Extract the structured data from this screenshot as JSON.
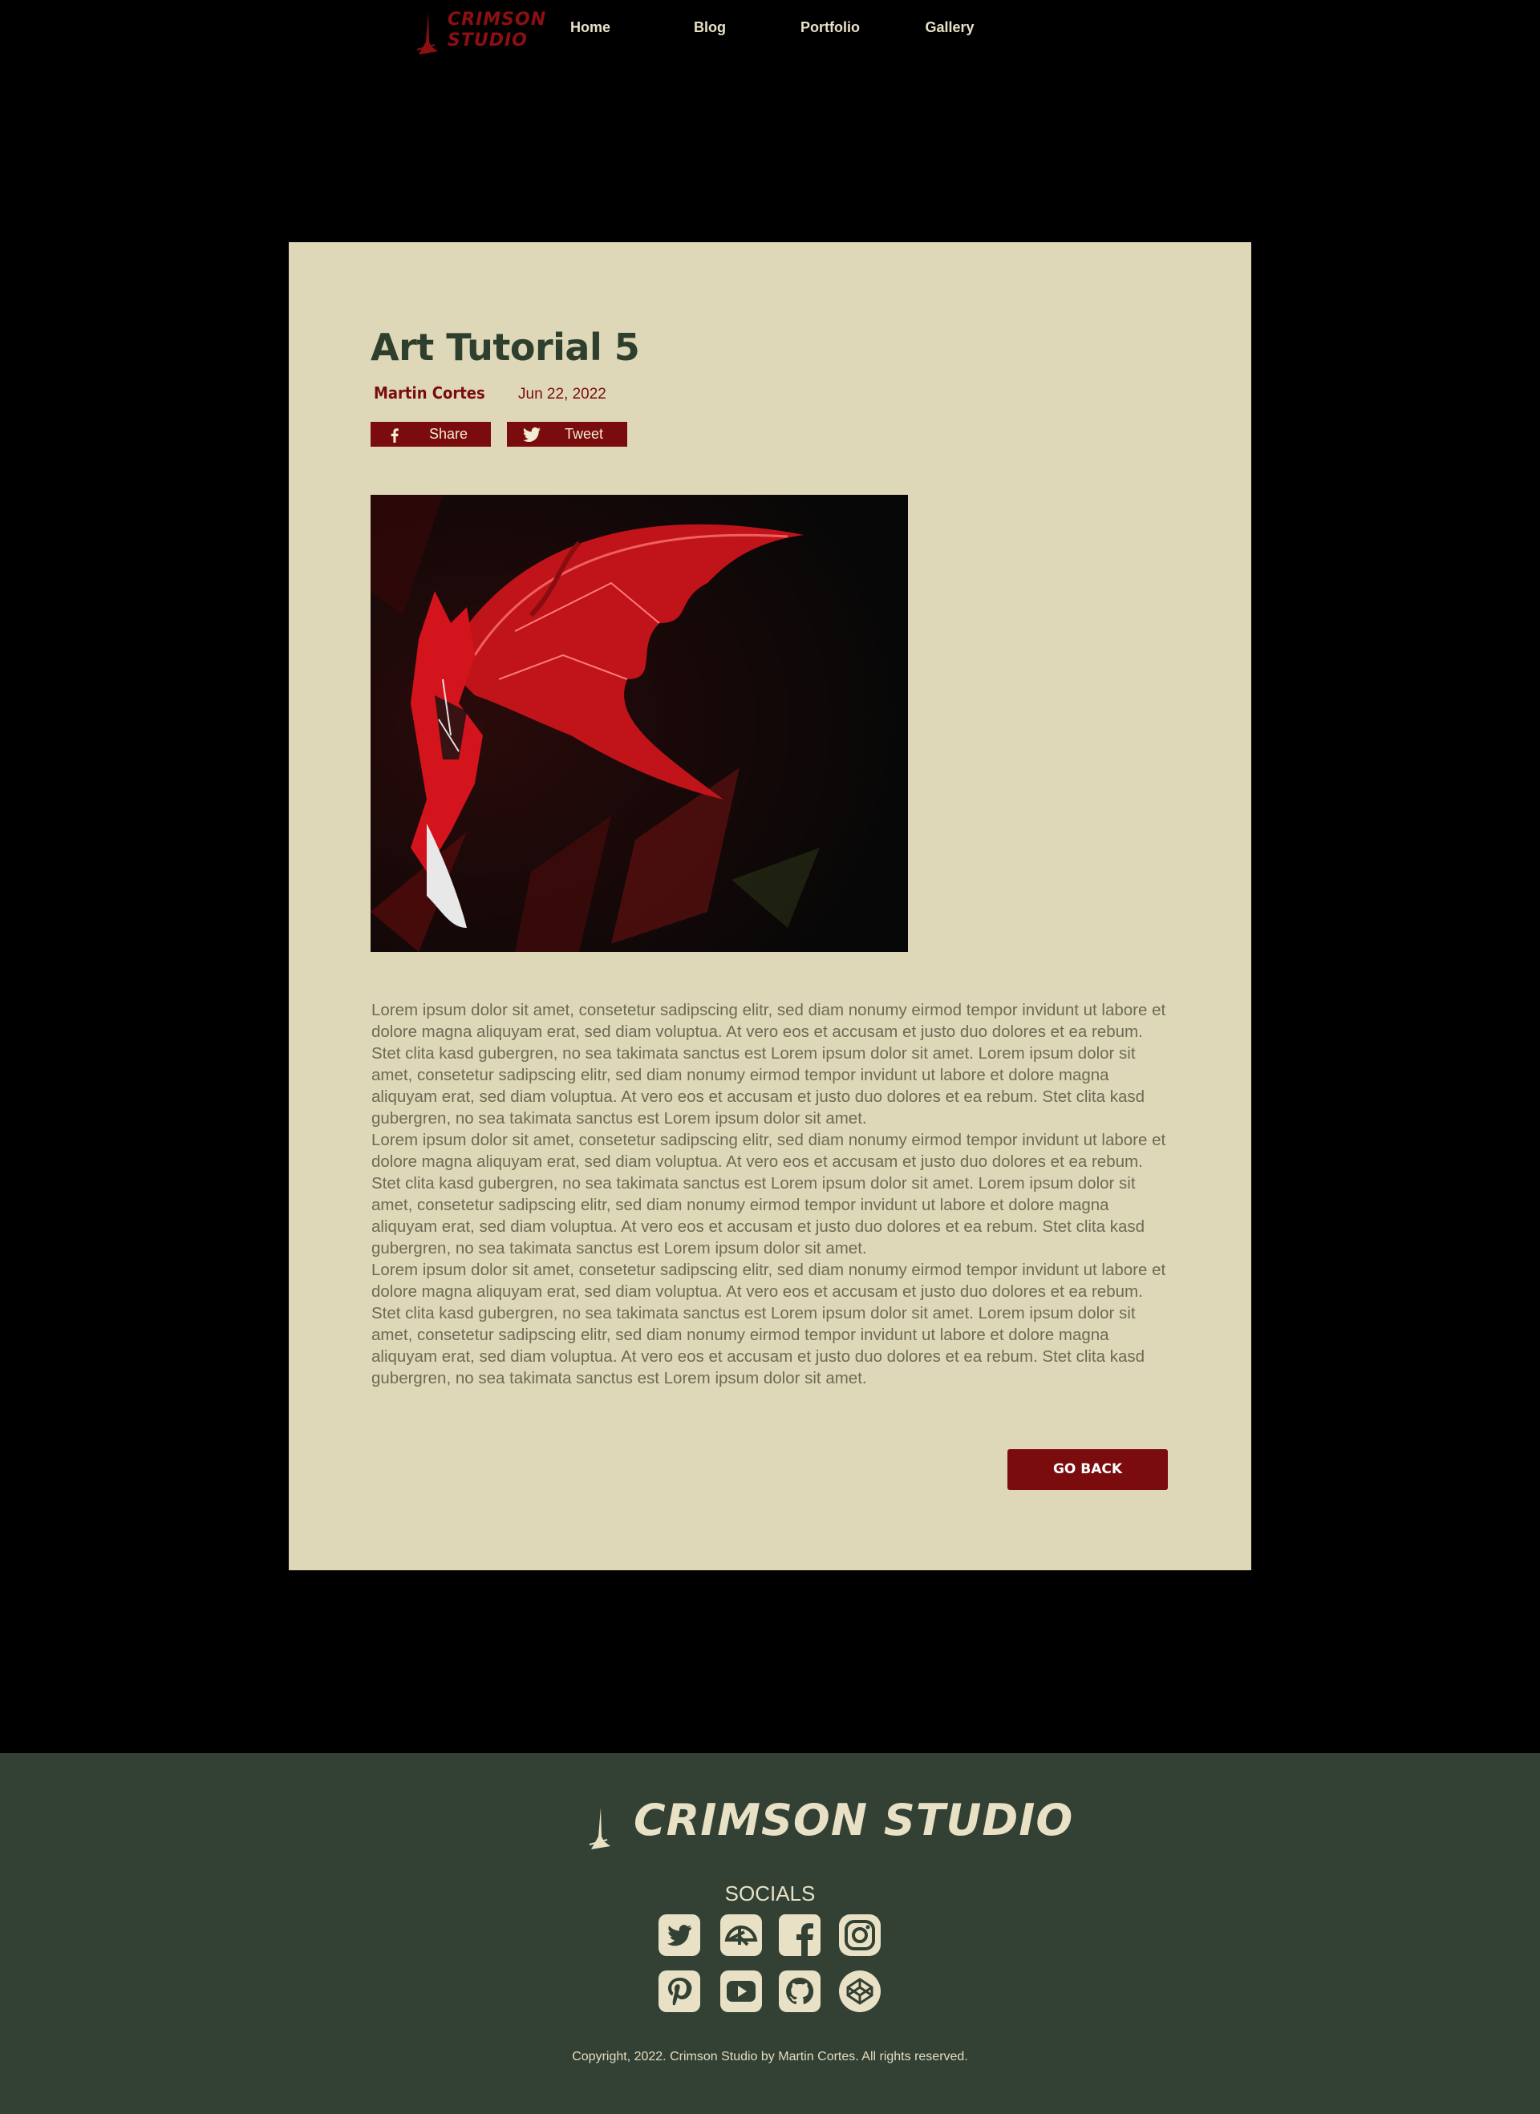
{
  "nav": {
    "logo_line1": "CRIMSON",
    "logo_line2": "STUDIO",
    "items": [
      "Home",
      "Blog",
      "Portfolio",
      "Gallery"
    ]
  },
  "post": {
    "title": "Art Tutorial 5",
    "author": "Martin Cortes",
    "date": "Jun 22, 2022",
    "share_label": "Share",
    "tweet_label": "Tweet",
    "paragraphs": [
      "Lorem ipsum dolor sit amet, consetetur sadipscing elitr, sed diam nonumy eirmod tempor invidunt ut labore et dolore magna aliquyam erat, sed diam voluptua. At vero eos et accusam et justo duo dolores et ea rebum. Stet clita kasd gubergren, no sea takimata sanctus est Lorem ipsum dolor sit amet. Lorem ipsum dolor sit amet, consetetur sadipscing elitr, sed diam nonumy eirmod tempor invidunt ut labore et dolore magna aliquyam erat, sed diam voluptua. At vero eos et accusam et justo duo dolores et ea rebum. Stet clita kasd gubergren, no sea takimata sanctus est Lorem ipsum dolor sit amet.",
      "Lorem ipsum dolor sit amet, consetetur sadipscing elitr, sed diam nonumy eirmod tempor invidunt ut labore et dolore magna aliquyam erat, sed diam voluptua. At vero eos et accusam et justo duo dolores et ea rebum. Stet clita kasd gubergren, no sea takimata sanctus est Lorem ipsum dolor sit amet. Lorem ipsum dolor sit amet, consetetur sadipscing elitr, sed diam nonumy eirmod tempor invidunt ut labore et dolore magna aliquyam erat, sed diam voluptua. At vero eos et accusam et justo duo dolores et ea rebum. Stet clita kasd gubergren, no sea takimata sanctus est Lorem ipsum dolor sit amet.",
      "Lorem ipsum dolor sit amet, consetetur sadipscing elitr, sed diam nonumy eirmod tempor invidunt ut labore et dolore magna aliquyam erat, sed diam voluptua. At vero eos et accusam et justo duo dolores et ea rebum. Stet clita kasd gubergren, no sea takimata sanctus est Lorem ipsum dolor sit amet. Lorem ipsum dolor sit amet, consetetur sadipscing elitr, sed diam nonumy eirmod tempor invidunt ut labore et dolore magna aliquyam erat, sed diam voluptua. At vero eos et accusam et justo duo dolores et ea rebum. Stet clita kasd gubergren, no sea takimata sanctus est Lorem ipsum dolor sit amet."
    ],
    "go_back_label": "GO BACK"
  },
  "footer": {
    "logo_text": "CRIMSON STUDIO",
    "socials_title": "SOCIALS",
    "social_icons": [
      "twitter-icon",
      "deviantart-icon",
      "facebook-icon",
      "instagram-icon",
      "pinterest-icon",
      "youtube-icon",
      "github-icon",
      "codepen-icon"
    ],
    "copyright": "Copyright, 2022. Crimson Studio by Martin Cortes. All rights reserved."
  },
  "colors": {
    "page_bg": "#000000",
    "card_bg": "#ded8b8",
    "accent": "#7a0c0e",
    "heading": "#2e3f2d",
    "footer_bg": "#324133",
    "cream": "#e9e1c6"
  }
}
